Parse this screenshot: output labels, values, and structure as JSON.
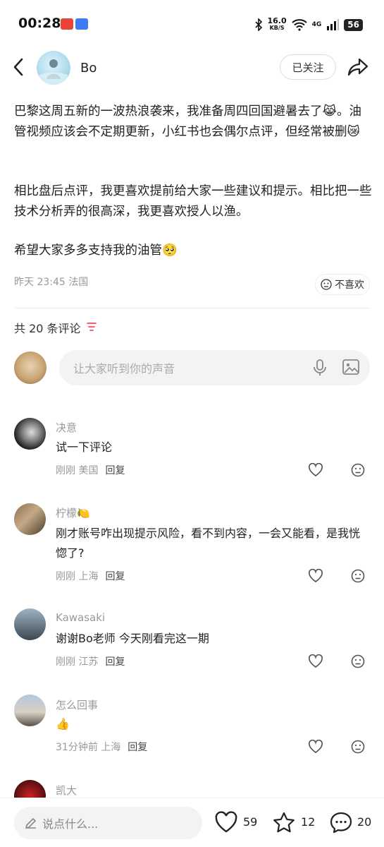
{
  "status_bar": {
    "time": "00:28",
    "net_speed": "16.0",
    "net_unit": "KB/S",
    "signal": "4G",
    "battery": "56"
  },
  "header": {
    "author_name": "Bo",
    "follow_label": "已关注"
  },
  "post": {
    "para1": "巴黎这周五新的一波热浪袭来，我准备周四回国避暑去了😹。油管视频应该会不定期更新，小红书也会偶尔点评，但经常被删😿",
    "para2": "相比盘后点评，我更喜欢提前给大家一些建议和提示。相比把一些技术分析弄的很高深，我更喜欢授人以渔。",
    "para3": "希望大家多多支持我的油管🥺",
    "meta": "昨天 23:45 法国",
    "dislike_label": "不喜欢"
  },
  "comments_header": {
    "count_label": "共 20 条评论"
  },
  "comment_input": {
    "placeholder": "让大家听到你的声音"
  },
  "comments": [
    {
      "name": "决意",
      "text": "试一下评论",
      "time_loc": "刚刚 美国",
      "reply": "回复"
    },
    {
      "name": "柠檬🍋",
      "text": "刚才账号咋出现提示风险，看不到内容，一会又能看，是我恍惚了?",
      "time_loc": "刚刚 上海",
      "reply": "回复"
    },
    {
      "name": "Kawasaki",
      "text": "谢谢Bo老师 今天刚看完这一期",
      "time_loc": "刚刚 江苏",
      "reply": "回复"
    },
    {
      "name": "怎么回事",
      "text": "👍",
      "time_loc": "31分钟前 上海",
      "reply": "回复"
    },
    {
      "name": "凯大"
    }
  ],
  "bottom_bar": {
    "say_placeholder": "说点什么...",
    "likes": "59",
    "stars": "12",
    "comments": "20"
  },
  "colors": {
    "accent_red": "#ff2442",
    "text": "#222222",
    "muted": "#999999"
  }
}
